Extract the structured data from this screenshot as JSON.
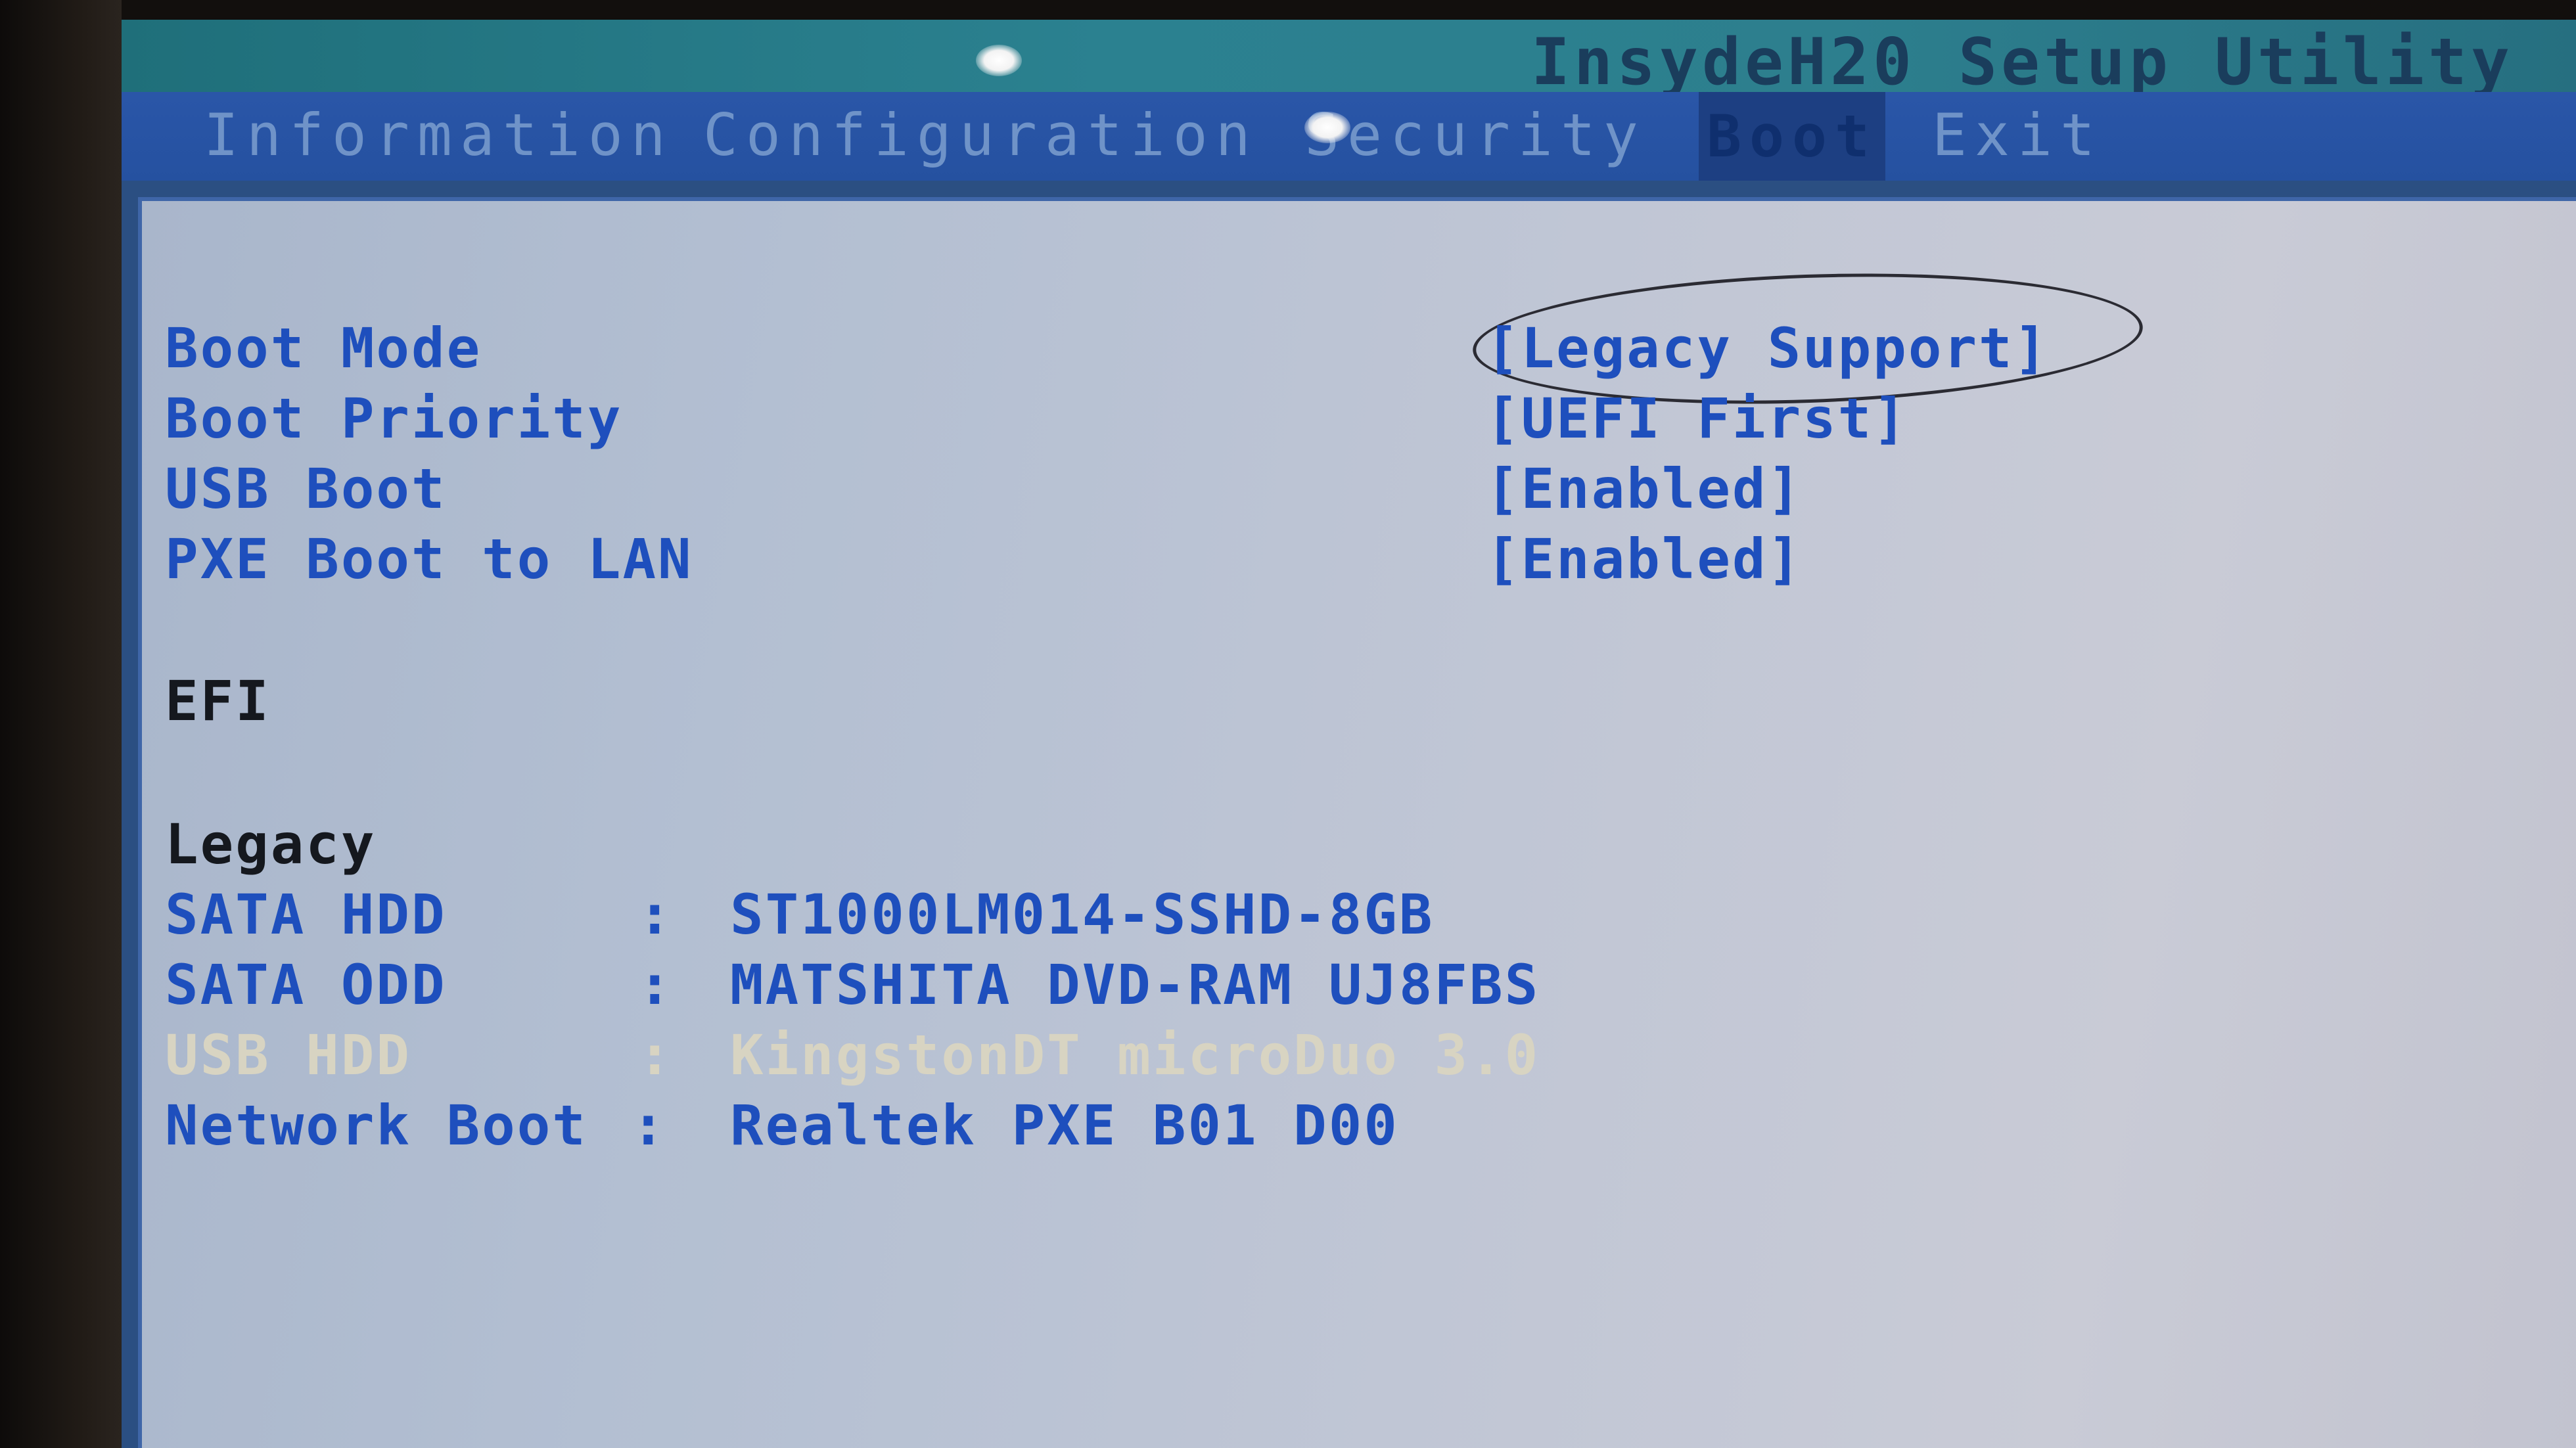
{
  "app": {
    "title": "InsydeH20 Setup Utility"
  },
  "menu": {
    "tabs": [
      {
        "label": "Information"
      },
      {
        "label": "Configuration"
      },
      {
        "label": "Security"
      },
      {
        "label": "Boot"
      },
      {
        "label": "Exit"
      }
    ],
    "active": "Boot"
  },
  "settings": [
    {
      "label": "Boot Mode",
      "value": "[Legacy Support]"
    },
    {
      "label": "Boot Priority",
      "value": "[UEFI First]"
    },
    {
      "label": "USB Boot",
      "value": "[Enabled]"
    },
    {
      "label": "PXE Boot to LAN",
      "value": "[Enabled]"
    }
  ],
  "sections": {
    "efi": "EFI",
    "legacy": "Legacy"
  },
  "legacy_devices": [
    {
      "type": "SATA HDD",
      "separator": ":",
      "name": "ST1000LM014-SSHD-8GB"
    },
    {
      "type": "SATA ODD",
      "separator": ":",
      "name": "MATSHITA DVD-RAM UJ8FBS"
    },
    {
      "type": "USB HDD",
      "separator": ":",
      "name": "KingstonDT microDuo 3.0"
    },
    {
      "type": "Network Boot",
      "separator": ":",
      "name": "Realtek PXE B01 D00"
    }
  ],
  "colors": {
    "menu_bar": "#2551a0",
    "title_bar": "#2b8190",
    "content_bg": "#b3bfd2",
    "label_blue": "#1e4fbd",
    "highlight_text": "#d8d4c2"
  }
}
